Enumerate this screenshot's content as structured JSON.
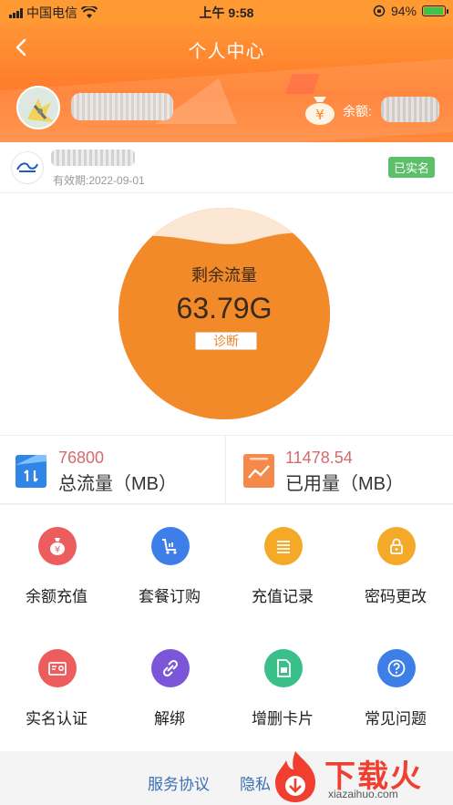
{
  "status_bar": {
    "carrier": "中国电信",
    "time": "上午 9:58",
    "battery": "94%",
    "battery_level": 0.94
  },
  "header": {
    "title": "个人中心",
    "balance_label": "余额:"
  },
  "account": {
    "validity": "有效期:2022-09-01",
    "badge": "已实名"
  },
  "gauge": {
    "label": "剩余流量",
    "value": "63.79G",
    "button": "诊断",
    "fill_fraction": 0.85
  },
  "stats": [
    {
      "value": "76800",
      "label": "总流量（MB）"
    },
    {
      "value": "11478.54",
      "label": "已用量（MB）"
    }
  ],
  "menu": [
    {
      "label": "余额充值",
      "icon": "money-bag-icon",
      "color": "#ee5d5d"
    },
    {
      "label": "套餐订购",
      "icon": "cart-icon",
      "color": "#3d7ee8"
    },
    {
      "label": "充值记录",
      "icon": "list-icon",
      "color": "#f4a928"
    },
    {
      "label": "密码更改",
      "icon": "lock-icon",
      "color": "#f4a928"
    },
    {
      "label": "实名认证",
      "icon": "id-card-icon",
      "color": "#ee5d5d"
    },
    {
      "label": "解绑",
      "icon": "unlink-icon",
      "color": "#7b56d9"
    },
    {
      "label": "增删卡片",
      "icon": "sim-card-icon",
      "color": "#3bbf8a"
    },
    {
      "label": "常见问题",
      "icon": "question-icon",
      "color": "#3d7ee8"
    }
  ],
  "footer": {
    "links": [
      "服务协议",
      "隐私"
    ]
  },
  "watermark": {
    "text": "下载火",
    "url": "xiazaihuo.com"
  },
  "colors": {
    "primary": "#ff7a2a",
    "gauge": "#f28a2a",
    "link": "#3b6fb6",
    "verified": "#5cc06a"
  }
}
